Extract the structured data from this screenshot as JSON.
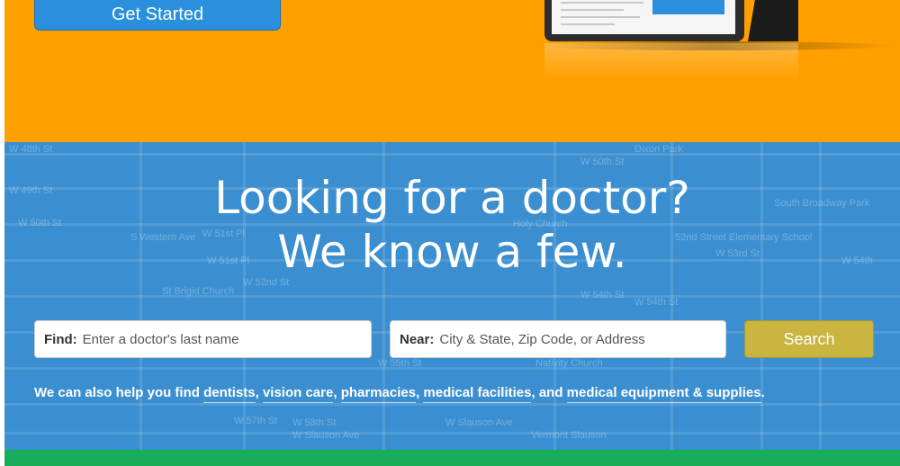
{
  "hero": {
    "get_started_label": "Get Started",
    "background_color": "#ffa000",
    "button_color": "#2a8fdc"
  },
  "map": {
    "background_color": "#3b8fd1",
    "street_labels": [
      "W 48th St",
      "W 49th St",
      "W 50th St",
      "S Western Ave",
      "W 51st Pl",
      "W 51st Pl",
      "W 52nd St",
      "St Brigid Church",
      "W 54th St",
      "W 55th St",
      "W 57th St",
      "W 58th St",
      "W Slauson Ave",
      "W Slauson Ave",
      "Vermont Slauson",
      "Dixon Park",
      "W 50th St",
      "South Broadway Park",
      "W 54th",
      "Nativity Church",
      "Holy Church",
      "52nd Street Elementary School",
      "W 53rd St",
      "W 54th St"
    ]
  },
  "headline": {
    "line1": "Looking for a doctor?",
    "line2": "We know a few."
  },
  "search": {
    "find_label": "Find:",
    "find_placeholder": "Enter a doctor's last name",
    "near_label": "Near:",
    "near_placeholder": "City & State, Zip Code, or Address",
    "button_label": "Search",
    "button_color": "#c9b53f"
  },
  "help": {
    "prefix": "We can also help you find ",
    "links": [
      "dentists",
      "vision care",
      "pharmacies",
      "medical facilities",
      "medical equipment & supplies"
    ],
    "and_text": "and ",
    "period": "."
  },
  "footer": {
    "bar_color": "#18ad5a"
  }
}
